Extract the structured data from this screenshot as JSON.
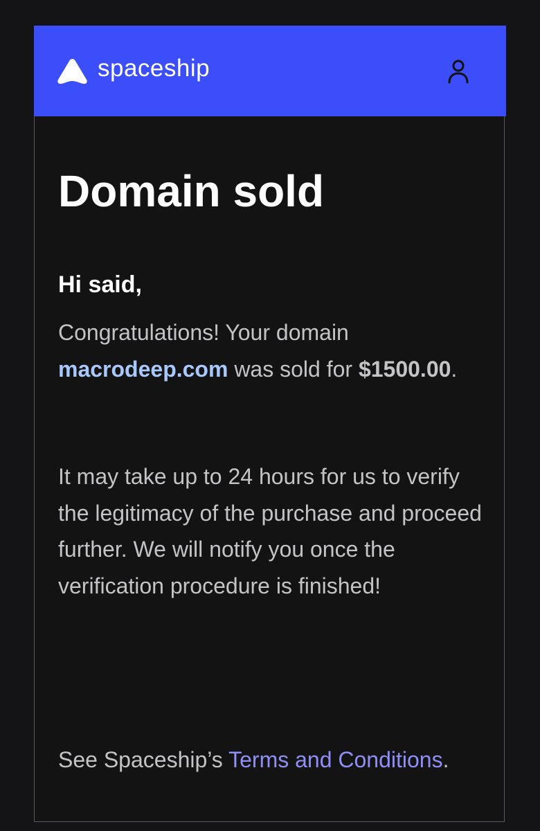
{
  "header": {
    "brand_name": "spaceship",
    "logo_icon": "spaceship-logo-icon",
    "account_icon": "user-icon",
    "background_color": "#3b4ef9"
  },
  "email": {
    "title": "Domain sold",
    "greeting": "Hi said,",
    "para1": {
      "text_before_domain": "Congratulations! Your domain ",
      "domain": "macrodeep.com",
      "text_after_domain": " was sold for ",
      "amount": "$1500.00",
      "text_end": "."
    },
    "para2": "It may take up to 24 hours for us to verify the legitimacy of the purchase and proceed further. We will notify you once the verification procedure is finished!",
    "footer": {
      "prefix": "See Spaceship’s ",
      "link_text": "Terms and Conditions",
      "suffix": "."
    }
  },
  "colors": {
    "link": "#a8c7fa",
    "terms_link": "#8f8ff5",
    "body_text": "#c4c4c6",
    "card_background": "#131314"
  }
}
